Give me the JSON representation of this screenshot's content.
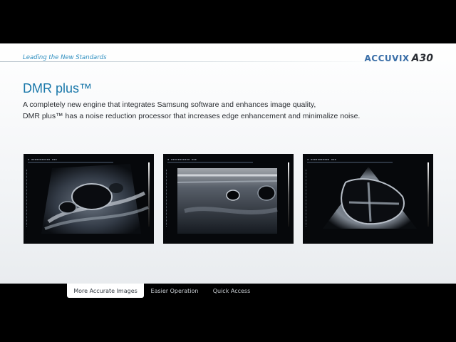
{
  "header": {
    "section_label": "Leading the New Standards",
    "brand": "ACCUVIX",
    "model": "A30"
  },
  "content": {
    "title": "DMR plus™",
    "description_lines": [
      "A completely new engine that integrates Samsung software and enhances image quality,",
      "DMR plus™ has a noise reduction processor that increases edge enhancement and minimalize noise."
    ]
  },
  "images": [
    {
      "name": "ultrasound-image-1"
    },
    {
      "name": "ultrasound-image-2"
    },
    {
      "name": "ultrasound-image-3"
    }
  ],
  "tabs": [
    {
      "label": "More Accurate Images",
      "active": true
    },
    {
      "label": "Easier Operation",
      "active": false
    },
    {
      "label": "Quick Access",
      "active": false
    }
  ],
  "colors": {
    "accent": "#1a78aa",
    "section_label": "#2f8fc0",
    "brand": "#3b6fa8"
  }
}
